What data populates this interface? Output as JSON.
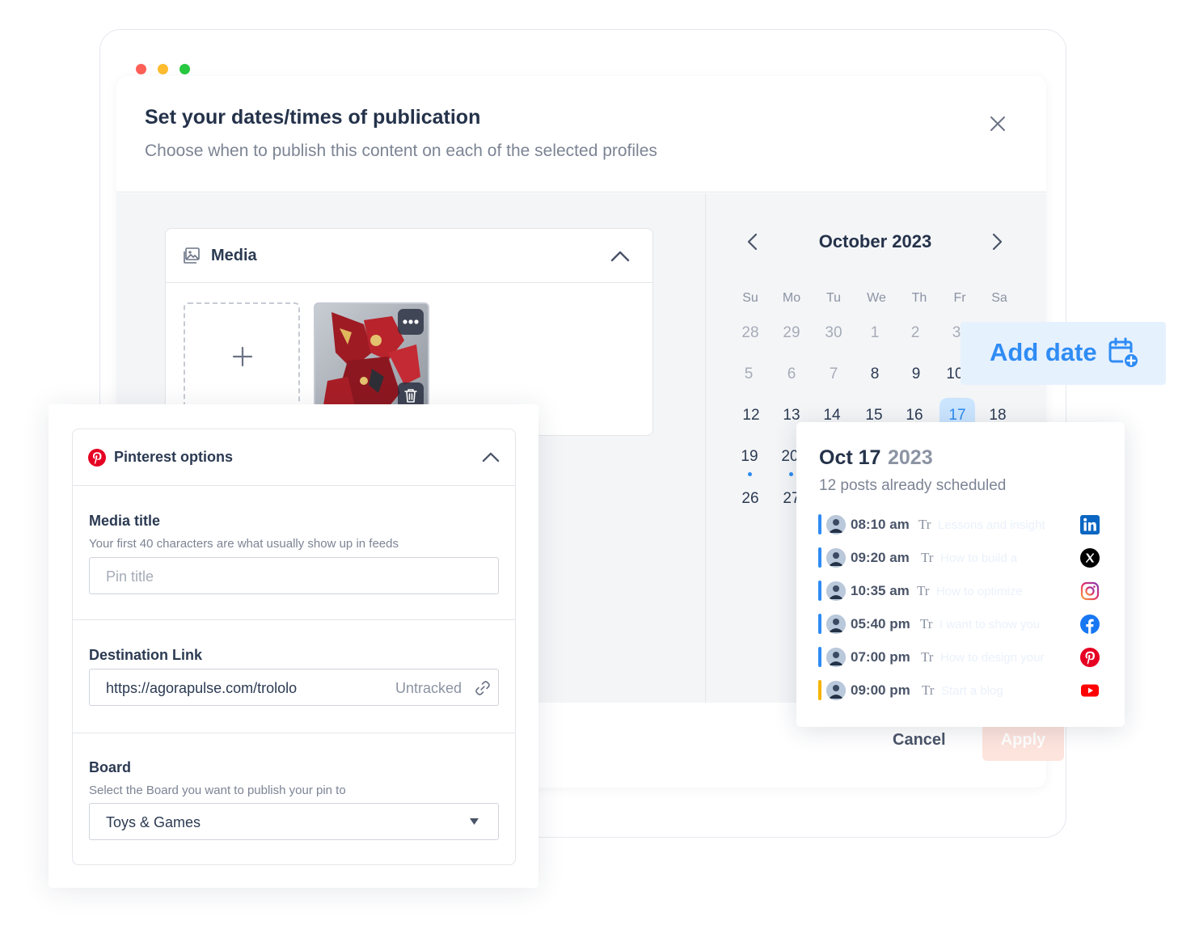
{
  "modal": {
    "title": "Set your dates/times of publication",
    "subtitle": "Choose when to publish this content on each of the selected profiles"
  },
  "media": {
    "title": "Media"
  },
  "calendar": {
    "month": "October 2023",
    "weekdays": [
      "Su",
      "Mo",
      "Tu",
      "We",
      "Th",
      "Fr",
      "Sa"
    ],
    "weeks": [
      [
        "28",
        "29",
        "30",
        "1",
        "2",
        "3",
        ""
      ],
      [
        "5",
        "6",
        "7",
        "8",
        "9",
        "10",
        ""
      ],
      [
        "12",
        "13",
        "14",
        "15",
        "16",
        "17",
        "18"
      ],
      [
        "19",
        "20",
        "",
        "",
        "",
        "",
        ""
      ],
      [
        "26",
        "27",
        "",
        "",
        "",
        "",
        ""
      ]
    ],
    "selected_day": "17"
  },
  "add_date": {
    "label": "Add date"
  },
  "day_popover": {
    "date": "Oct 17",
    "year": "2023",
    "subtitle": "12 posts already scheduled",
    "posts": [
      {
        "time": "08:10 am",
        "text": "Lessons and insight",
        "network": "linkedin-icon",
        "bar_color": "#2f8cf4"
      },
      {
        "time": "09:20 am",
        "text": "How to build a",
        "network": "x-icon",
        "bar_color": "#2f8cf4"
      },
      {
        "time": "10:35 am",
        "text": "How to optimize",
        "network": "instagram-icon",
        "bar_color": "#2f8cf4"
      },
      {
        "time": "05:40 pm",
        "text": "I want to show you",
        "network": "facebook-icon",
        "bar_color": "#2f8cf4"
      },
      {
        "time": "07:00 pm",
        "text": "How to design your",
        "network": "pinterest-icon",
        "bar_color": "#2f8cf4"
      },
      {
        "time": "09:00 pm",
        "text": "Start a blog",
        "network": "youtube-icon",
        "bar_color": "#f5b400"
      }
    ],
    "format_glyph": "Tr"
  },
  "footer": {
    "cancel_label": "Cancel",
    "apply_label": "Apply"
  },
  "pinterest": {
    "title": "Pinterest options",
    "media_title": {
      "label": "Media title",
      "help": "Your first 40 characters are what usually show up in feeds",
      "placeholder": "Pin title"
    },
    "destination": {
      "label": "Destination Link",
      "value": "https://agorapulse.com/trololo",
      "tracking": "Untracked"
    },
    "board": {
      "label": "Board",
      "help": "Select the Board you want to publish your pin to",
      "value": "Toys & Games"
    }
  },
  "colors": {
    "accent_blue": "#2f8cf4",
    "selected_day_bg": "#cbe5ff",
    "apply_disabled": "#fde4dc",
    "pinterest_red": "#e60023"
  }
}
